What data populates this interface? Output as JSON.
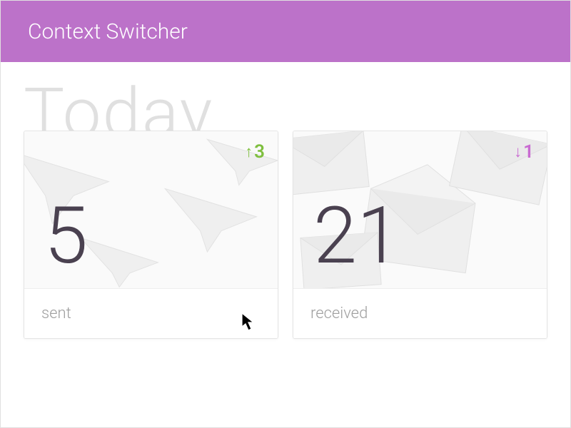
{
  "header": {
    "title": "Context Switcher"
  },
  "page": {
    "heading": "Today"
  },
  "cards": {
    "sent": {
      "value": "5",
      "delta": "3",
      "label": "sent"
    },
    "received": {
      "value": "21",
      "delta": "1",
      "label": "received"
    }
  }
}
